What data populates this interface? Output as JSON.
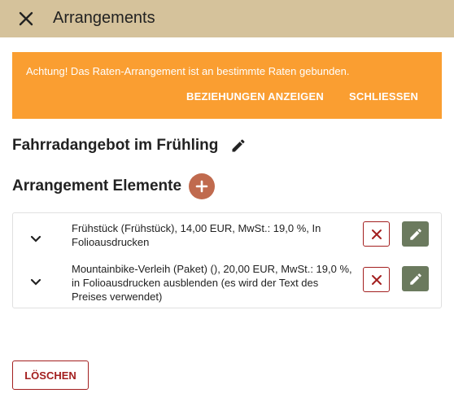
{
  "header": {
    "close_icon": "close-icon",
    "title": "Arrangements"
  },
  "banner": {
    "message": "Achtung! Das Raten-Arrangement ist an bestimmte Raten gebunden.",
    "show_relations_label": "BEZIEHUNGEN ANZEIGEN",
    "close_label": "SCHLIESSEN",
    "background": "#fa9e31"
  },
  "arrangement": {
    "title": "Fahrradangebot im Frühling",
    "edit_icon": "pencil-icon"
  },
  "elements": {
    "title": "Arrangement Elemente",
    "add_icon": "plus-icon",
    "items": [
      {
        "text": "Frühstück (Frühstück), 14,00 EUR, MwSt.: 19,0 %, In Folioausdrucken",
        "expand_icon": "chevron-down-icon",
        "delete_icon": "close-icon",
        "edit_icon": "pencil-icon"
      },
      {
        "text": "Mountainbike-Verleih (Paket) (), 20,00 EUR, MwSt.: 19,0 %, in Folioausdrucken ausblenden (es wird der Text des Preises verwendet)",
        "expand_icon": "chevron-down-icon",
        "delete_icon": "close-icon",
        "edit_icon": "pencil-icon"
      }
    ]
  },
  "footer": {
    "delete_label": "LÖSCHEN"
  },
  "colors": {
    "header_bg": "#d5c29b",
    "accent_add": "#c06a4e",
    "danger": "#a31f1f",
    "edit_btn": "#6b7a5e"
  }
}
